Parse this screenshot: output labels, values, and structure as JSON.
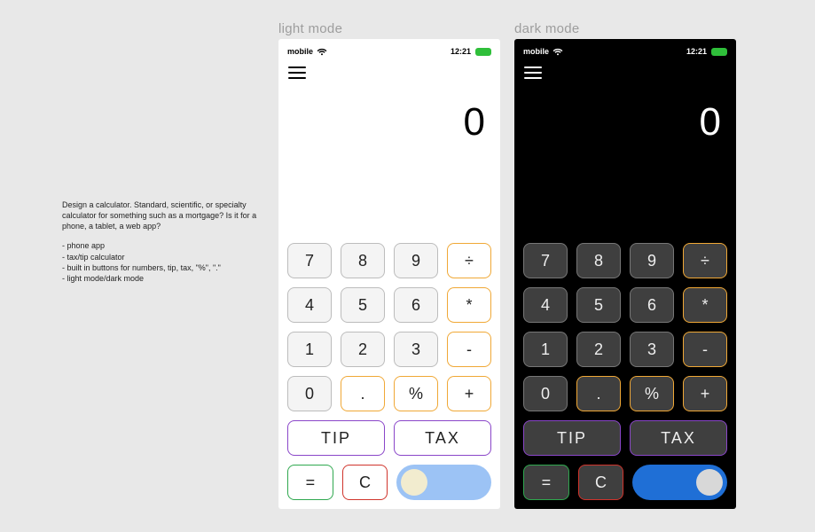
{
  "modes": {
    "light_label": "light mode",
    "dark_label": "dark mode"
  },
  "statusbar": {
    "carrier": "mobile",
    "time": "12:21"
  },
  "display": {
    "value": "0"
  },
  "keys": {
    "n7": "7",
    "n8": "8",
    "n9": "9",
    "div": "÷",
    "n4": "4",
    "n5": "5",
    "n6": "6",
    "mul": "*",
    "n1": "1",
    "n2": "2",
    "n3": "3",
    "sub": "-",
    "n0": "0",
    "dot": ".",
    "pct": "%",
    "add": "+",
    "tip": "TIP",
    "tax": "TAX",
    "eq": "=",
    "clr": "C"
  },
  "brief": {
    "prompt": "Design a calculator. Standard, scientific, or specialty calculator for something such as a mortgage? Is it for a phone, a tablet, a web app?",
    "bullets": {
      "b1": "phone app",
      "b2": "tax/tip calculator",
      "b3": "built in buttons for numbers, tip, tax, \"%\", \".\"",
      "b4": "light mode/dark mode"
    }
  }
}
